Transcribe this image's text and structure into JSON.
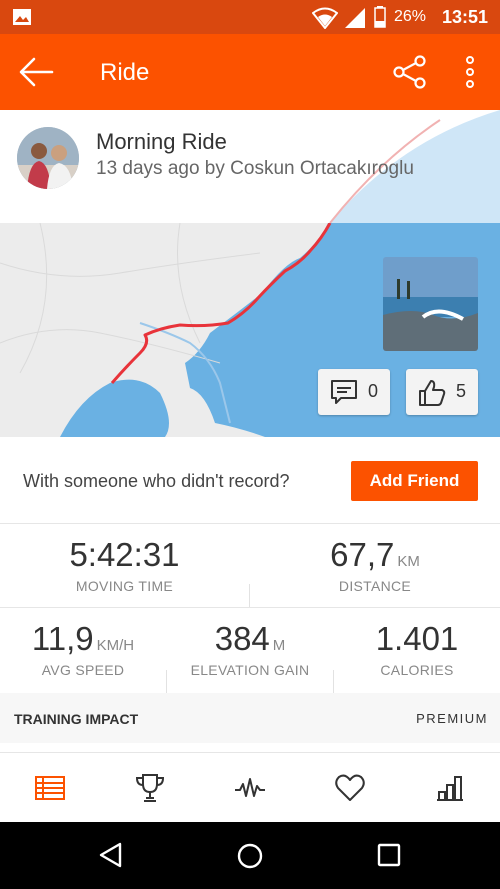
{
  "status_bar": {
    "battery_percent": "26%",
    "time": "13:51",
    "icons": [
      "image-icon",
      "wifi-icon",
      "signal-icon",
      "battery-icon"
    ]
  },
  "app_bar": {
    "title": "Ride",
    "icons": [
      "back-arrow-icon",
      "share-icon",
      "more-vert-icon"
    ]
  },
  "activity": {
    "name": "Morning Ride",
    "subtitle": "13 days ago by Coskun Ortacakıroglu"
  },
  "map": {
    "comment_count": "0",
    "kudos_count": "5",
    "icons": [
      "comment-icon",
      "thumbs-up-icon"
    ]
  },
  "friend_prompt": {
    "text": "With someone who didn't record?",
    "button": "Add Friend"
  },
  "stats": {
    "moving_time": {
      "value": "5:42:31",
      "unit": "",
      "label": "MOVING TIME"
    },
    "distance": {
      "value": "67,7",
      "unit": "KM",
      "label": "DISTANCE"
    },
    "avg_speed": {
      "value": "11,9",
      "unit": "KM/H",
      "label": "AVG SPEED"
    },
    "elevation_gain": {
      "value": "384",
      "unit": "M",
      "label": "ELEVATION GAIN"
    },
    "calories": {
      "value": "1.401",
      "unit": "",
      "label": "CALORIES"
    }
  },
  "training_impact": {
    "title": "TRAINING IMPACT",
    "badge": "PREMIUM"
  },
  "tabs": [
    {
      "icon": "overview-list-icon",
      "active": true
    },
    {
      "icon": "trophy-icon",
      "active": false
    },
    {
      "icon": "analysis-wave-icon",
      "active": false
    },
    {
      "icon": "heart-icon",
      "active": false
    },
    {
      "icon": "bar-chart-icon",
      "active": false
    }
  ],
  "colors": {
    "brand": "#fc5200",
    "status_bar": "#d9480f",
    "route": "#e8333a",
    "water": "#6ab1e3"
  }
}
